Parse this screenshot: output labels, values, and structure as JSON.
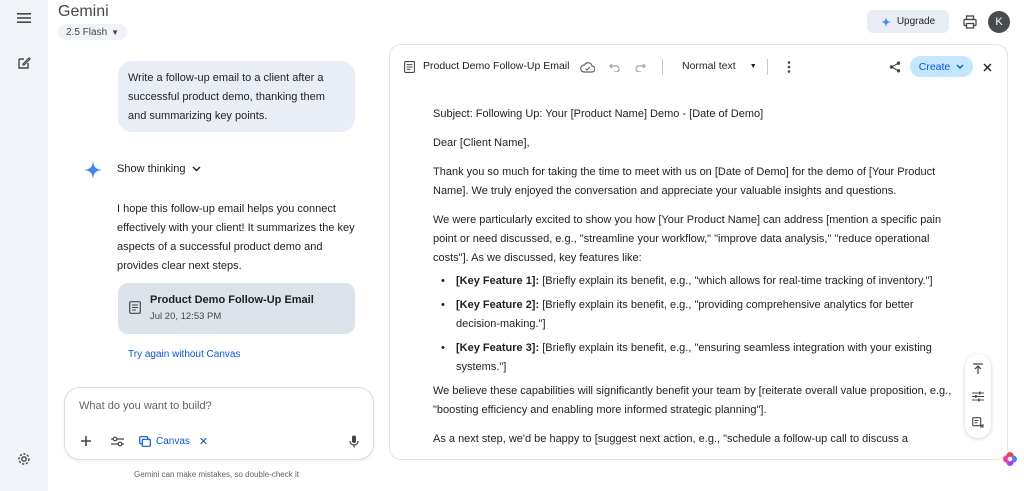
{
  "app": {
    "title": "Gemini",
    "model": "2.5 Flash"
  },
  "header": {
    "upgrade_label": "Upgrade",
    "avatar_letter": "K"
  },
  "chat": {
    "user_prompt": "Write a follow-up email to a client after a successful product demo, thanking them and summarizing key points.",
    "show_thinking": "Show thinking",
    "reply": "I hope this follow-up email helps you connect effectively with your client! It summarizes the key aspects of a successful product demo and provides clear next steps.",
    "doc_card": {
      "title": "Product Demo Follow-Up Email",
      "date": "Jul 20, 12:53 PM"
    },
    "try_again": "Try again without Canvas"
  },
  "input": {
    "placeholder": "What do you want to build?",
    "canvas_chip": "Canvas"
  },
  "disclaimer": "Gemini can make mistakes, so double-check it",
  "canvas": {
    "title": "Product Demo Follow-Up Email",
    "text_style": "Normal text",
    "create_label": "Create",
    "doc": {
      "subject": "Subject: Following Up: Your [Product Name] Demo - [Date of Demo]",
      "greeting": "Dear [Client Name],",
      "para1": "Thank you so much for taking the time to meet with us on [Date of Demo] for the demo of [Your Product Name]. We truly enjoyed the conversation and appreciate your valuable insights and questions.",
      "para2": "We were particularly excited to show you how [Your Product Name] can address [mention a specific pain point or need discussed, e.g., \"streamline your workflow,\" \"improve data analysis,\" \"reduce operational costs\"]. As we discussed, key features like:",
      "bullets": [
        {
          "label": "[Key Feature 1]:",
          "text": " [Briefly explain its benefit, e.g., \"which allows for real-time tracking of inventory.\"]"
        },
        {
          "label": "[Key Feature 2]:",
          "text": " [Briefly explain its benefit, e.g., \"providing comprehensive analytics for better decision-making.\"]"
        },
        {
          "label": "[Key Feature 3]:",
          "text": " [Briefly explain its benefit, e.g., \"ensuring seamless integration with your existing systems.\"]"
        }
      ],
      "para3": "We believe these capabilities will significantly benefit your team by [reiterate overall value proposition, e.g., \"boosting efficiency and enabling more informed strategic planning\"].",
      "para4": "As a next step, we'd be happy to [suggest next action, e.g., \"schedule a follow-up call to discuss a"
    }
  },
  "colors": {
    "accent": "#0b57d0",
    "create_bg": "#c2e7ff",
    "rail_bg": "#f0f4f9",
    "bubble_bg": "#e9eef6"
  }
}
